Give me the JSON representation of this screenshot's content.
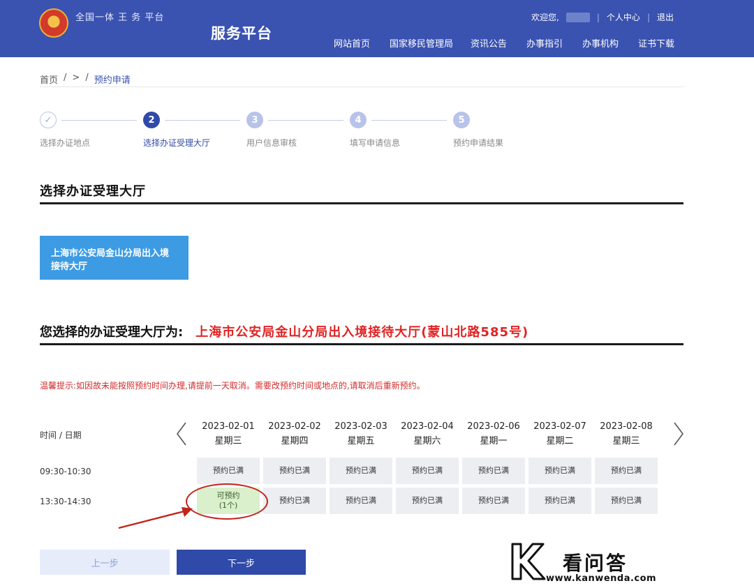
{
  "header": {
    "site_name": "全国一体  王  务       平台",
    "platform_title": "服务平台",
    "welcome": "欢迎您,",
    "personal_center": "个人中心",
    "logout": "退出",
    "nav": [
      "网站首页",
      "国家移民管理局",
      "资讯公告",
      "办事指引",
      "办事机构",
      "证书下载"
    ]
  },
  "breadcrumb": {
    "home": "首页",
    "sep1": "/",
    "mid": ">",
    "sep2": "/",
    "current": "预约申请"
  },
  "steps": [
    {
      "num": "✓",
      "label": "选择办证地点"
    },
    {
      "num": "2",
      "label": "选择办证受理大厅"
    },
    {
      "num": "3",
      "label": "用户信息审核"
    },
    {
      "num": "4",
      "label": "填写申请信息"
    },
    {
      "num": "5",
      "label": "预约申请结果"
    }
  ],
  "section": {
    "title": "选择办证受理大厅",
    "hall_button": "上海市公安局金山分局出入境接待大厅",
    "selected_prefix": "您选择的办证受理大厅为:",
    "selected_hall": "上海市公安局金山分局出入境接待大厅(蒙山北路585号)",
    "tip": "温馨提示:如因故未能按照预约时间办理,请提前一天取消。需要改预约时间或地点的,请取消后重新预约。"
  },
  "schedule": {
    "header_label": "时间 / 日期",
    "dates": [
      {
        "date": "2023-02-01",
        "weekday": "星期三"
      },
      {
        "date": "2023-02-02",
        "weekday": "星期四"
      },
      {
        "date": "2023-02-03",
        "weekday": "星期五"
      },
      {
        "date": "2023-02-04",
        "weekday": "星期六"
      },
      {
        "date": "2023-02-06",
        "weekday": "星期一"
      },
      {
        "date": "2023-02-07",
        "weekday": "星期二"
      },
      {
        "date": "2023-02-08",
        "weekday": "星期三"
      }
    ],
    "slots": [
      {
        "time": "09:30-10:30",
        "cells": [
          "预约已满",
          "预约已满",
          "预约已满",
          "预约已满",
          "预约已满",
          "预约已满",
          "预约已满"
        ]
      },
      {
        "time": "13:30-14:30",
        "cells": [
          "可预约",
          "预约已满",
          "预约已满",
          "预约已满",
          "预约已满",
          "预约已满",
          "预约已满"
        ],
        "avail_count": "(1个)"
      }
    ]
  },
  "buttons": {
    "prev": "上一步",
    "next": "下一步"
  },
  "watermark": {
    "text": "看问答",
    "url": "www.kanwenda.com"
  },
  "colors": {
    "primary": "#2f4aa8",
    "header_bg": "#3a52b0",
    "hall_button": "#3d9be3",
    "alert_red": "#e02424",
    "available_bg": "#daefcc"
  }
}
